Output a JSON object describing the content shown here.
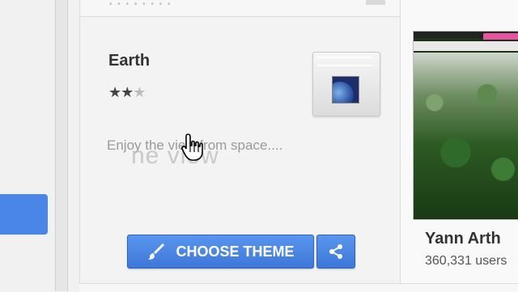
{
  "theme": {
    "title": "Earth",
    "rating_full": "★★",
    "rating_half": "★",
    "description": "Enjoy the view from space....",
    "overlay_text": "ne view",
    "choose_label": "CHOOSE THEME"
  },
  "next_theme": {
    "author": "Yann Arth",
    "users": "360,331 users"
  },
  "icons": {
    "brush": "brush-icon",
    "share": "share-icon",
    "cursor": "hand-cursor-icon"
  },
  "colors": {
    "accent": "#4a86e8",
    "tab_pink": "#e6539f"
  }
}
